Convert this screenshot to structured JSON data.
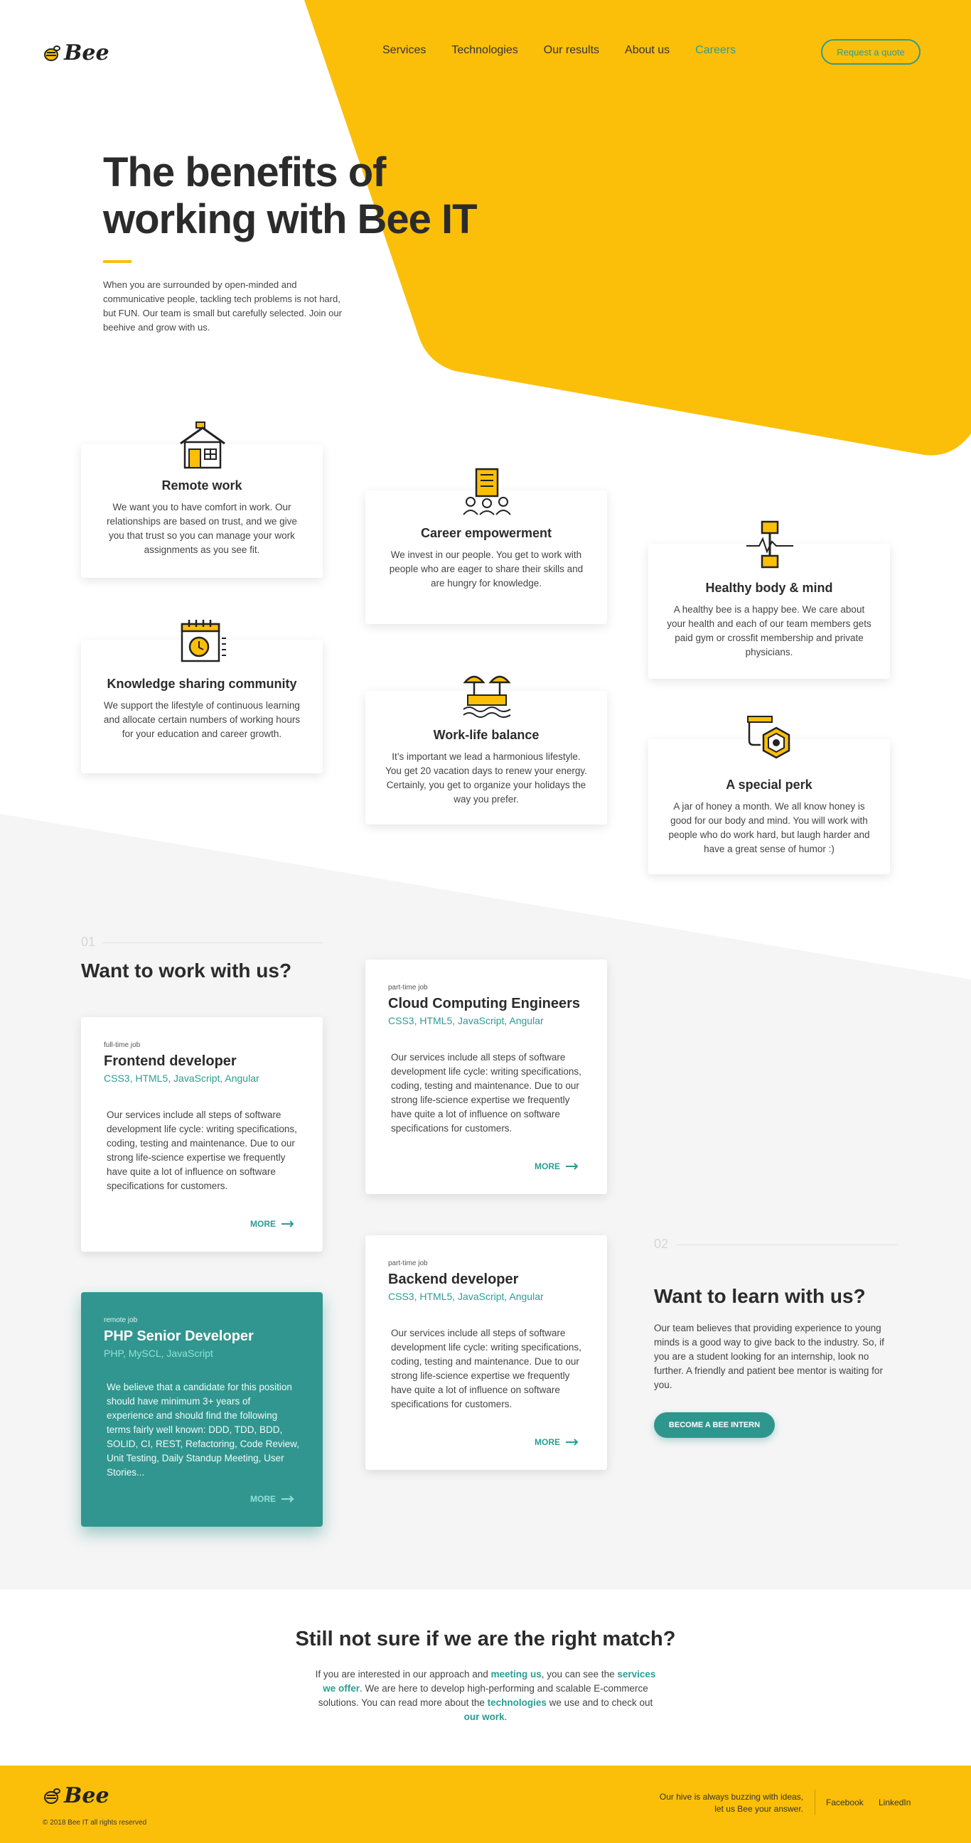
{
  "brand": {
    "logo_text": "Bee",
    "yellow": "#fbbf09",
    "teal": "#2a9d93"
  },
  "nav": {
    "items": [
      {
        "label": "Services"
      },
      {
        "label": "Technologies"
      },
      {
        "label": "Our results"
      },
      {
        "label": "About us"
      },
      {
        "label": "Careers"
      }
    ],
    "cta": "Request a quote"
  },
  "hero": {
    "title_line1": "The benefits of",
    "title_line2": "working with Bee IT",
    "text": "When you are surrounded by open-minded and communicative people, tackling tech problems is not hard, but FUN. Our team is small but carefully selected. Join our beehive and grow with us."
  },
  "benefits": [
    {
      "icon": "house-icon",
      "title": "Remote work",
      "text": "We want you to have comfort in work. Our relationships are based on trust, and we give you that trust so you can manage your work assignments as you see fit."
    },
    {
      "icon": "team-building-icon",
      "title": "Career empowerment",
      "text": "We invest in our people. You get to work with people who are eager to share their skills and are hungry for knowledge."
    },
    {
      "icon": "dumbbell-heartbeat-icon",
      "title": "Healthy body & mind",
      "text": "A healthy bee is a happy bee. We care about your health and each of our team members gets paid gym or crossfit membership and private physicians."
    },
    {
      "icon": "calendar-clock-icon",
      "title": "Knowledge sharing community",
      "text": "We support the lifestyle of continuous learning and allocate certain numbers of working hours for your education and career growth."
    },
    {
      "icon": "beach-umbrella-icon",
      "title": "Work-life balance",
      "text": "It’s important we lead a harmonious lifestyle. You get 20 vacation days to renew your energy. Certainly, you get to organize your holidays the way you prefer."
    },
    {
      "icon": "honey-jar-icon",
      "title": "A special perk",
      "text": "A jar of honey a month. We all know honey is good for our body and mind. You will work with people who do work hard, but laugh harder and have a great sense of humor :)"
    }
  ],
  "jobs_section": {
    "number": "01",
    "title": "Want to work with us?"
  },
  "jobs": [
    {
      "type": "full-time job",
      "title": "Frontend developer",
      "tags": "CSS3, HTML5, JavaScript, Angular",
      "text": "Our services include all steps of software development life cycle: writing specifications, coding, testing and maintenance. Due to our strong life-science expertise we frequently have quite a lot of influence on software specifications for customers.",
      "more": "MORE"
    },
    {
      "type": "part-time job",
      "title": "Cloud Computing Engineers",
      "tags": "CSS3, HTML5, JavaScript, Angular",
      "text": "Our services include all steps of software development life cycle: writing specifications, coding, testing and maintenance. Due to our strong life-science expertise we frequently have quite a lot of influence on software specifications for customers.",
      "more": "MORE"
    },
    {
      "type": "remote job",
      "title": "PHP Senior Developer",
      "tags": "PHP, MySCL, JavaScript",
      "text": "We believe that a candidate for this position should have minimum 3+ years of experience and should find the following terms fairly well known: DDD, TDD, BDD, SOLID, CI, REST, Refactoring, Code Review, Unit Testing, Daily Standup Meeting, User Stories...",
      "more": "MORE"
    },
    {
      "type": "part-time job",
      "title": "Backend developer",
      "tags": "CSS3, HTML5, JavaScript, Angular",
      "text": "Our services include all steps of software development life cycle: writing specifications, coding, testing and maintenance. Due to our strong life-science expertise we frequently have quite a lot of influence on software specifications for customers.",
      "more": "MORE"
    }
  ],
  "learn_section": {
    "number": "02",
    "title": "Want to learn with us?",
    "text": "Our team believes that providing experience to young minds is a good way to give back to the industry. So, if you are a student looking for an internship, look no further. A friendly and patient bee mentor is waiting for you.",
    "button": "BECOME A BEE INTERN"
  },
  "match": {
    "title": "Still not sure if we are the right match?",
    "t1": "If you are interested in our approach and ",
    "l1": "meeting us",
    "t2": ", you can see the ",
    "l2": "services we offer",
    "t3": ". We are here to develop high-performing and scalable E-commerce solutions.  You can read more about the ",
    "l3": "technologies",
    "t4": " we use and to check out ",
    "l4": "our work",
    "t5": "."
  },
  "footer": {
    "logo_text": "Bee",
    "copyright": "© 2018 Bee IT all rights reserved",
    "hive_line1": "Our hive is always buzzing with ideas,",
    "hive_line2": "let us Bee your answer.",
    "facebook": "Facebook",
    "linkedin": "LinkedIn"
  }
}
